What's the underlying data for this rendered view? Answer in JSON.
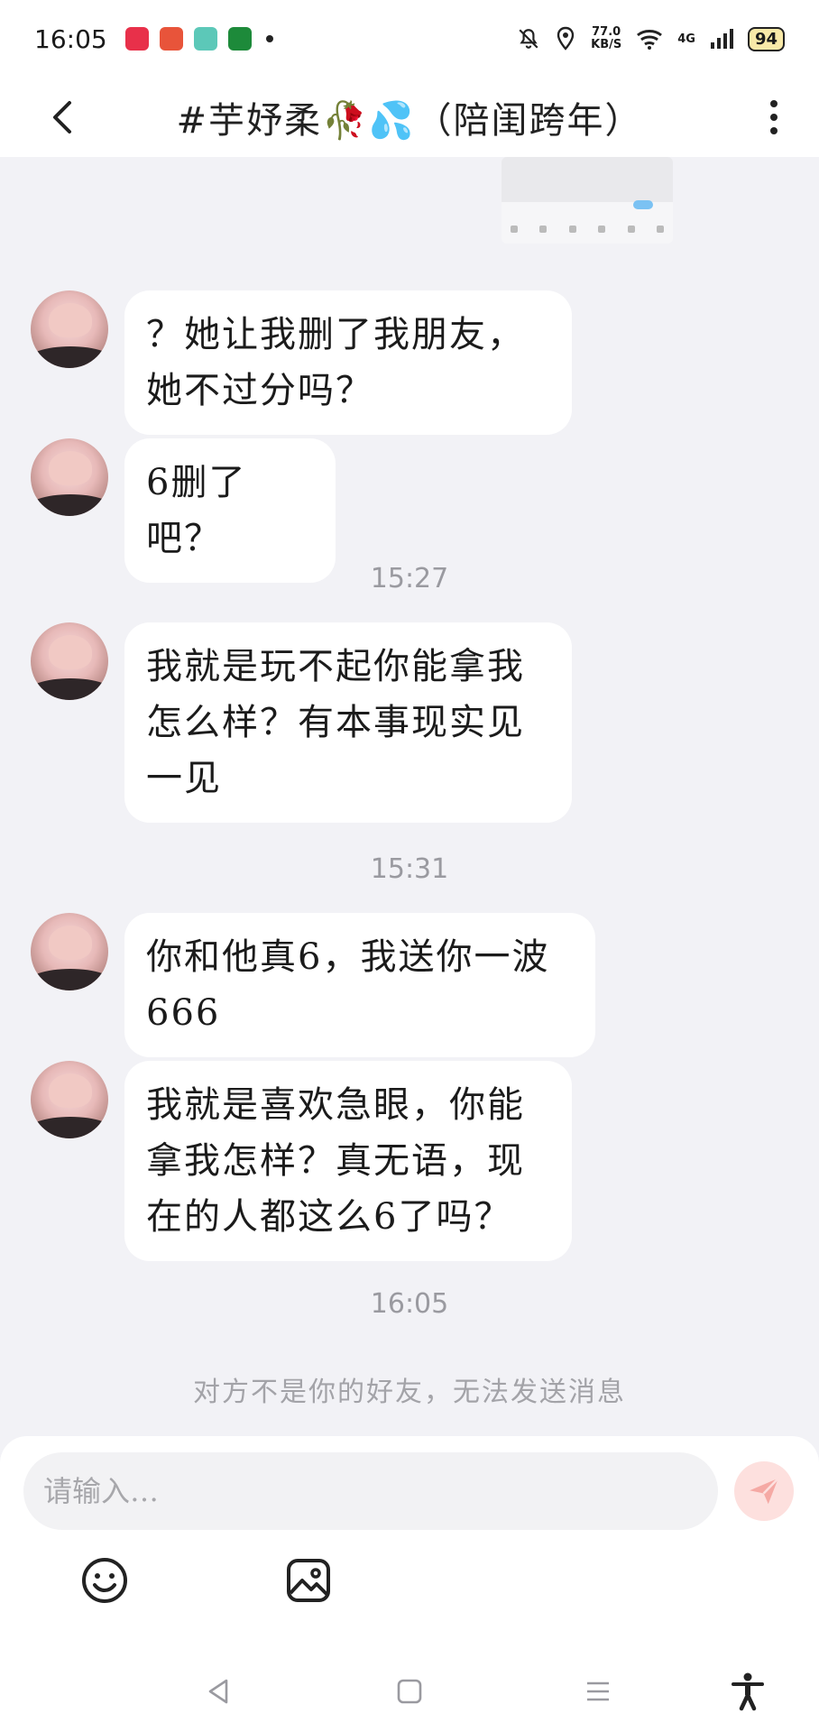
{
  "status_bar": {
    "time": "16:05",
    "speed_value": "77.0",
    "speed_unit": "KB/S",
    "network": "4G",
    "battery": "94",
    "app_icon_colors": [
      "#e8304a",
      "#e8543a",
      "#5cc8b8",
      "#1d8a3a"
    ]
  },
  "header": {
    "title": "#芋妤柔🥀💦（陪闺跨年）",
    "back_icon": "chevron-left-icon",
    "more_icon": "more-vertical-icon"
  },
  "messages": [
    {
      "text": "？她让我删了我朋友，她不过分吗？",
      "lines": [
        "？她让我删了我朋友，",
        "她不过分吗？"
      ]
    },
    {
      "text": "6删了吧？",
      "lines": [
        "6删了吧？"
      ]
    },
    {
      "text": "我就是玩不起你能拿我怎么样？有本事现实见一见",
      "lines": [
        "我就是玩不起你能拿我",
        "怎么样？有本事现实见",
        "一见"
      ]
    },
    {
      "text": "你和他真6，我送你一波666",
      "lines": [
        "你和他真6，我送你一波",
        "666"
      ]
    },
    {
      "text": "我就是喜欢急眼，你能拿我怎样？真无语，现在的人都这么6了吗？",
      "lines": [
        "我就是喜欢急眼，你能",
        "拿我怎样？真无语，现",
        "在的人都这么6了吗？"
      ]
    }
  ],
  "timestamps": [
    "15:27",
    "15:31",
    "16:05"
  ],
  "notice": "对方不是你的好友，无法发送消息",
  "input": {
    "placeholder": "请输入…",
    "send_icon": "send-icon",
    "emoji_icon": "emoji-icon",
    "image_icon": "image-icon"
  },
  "navbar": {
    "icons": [
      "back-triangle-icon",
      "home-square-icon",
      "menu-lines-icon",
      "accessibility-icon"
    ]
  },
  "colors": {
    "background": "#f2f2f6",
    "bubble": "#ffffff",
    "send_button": "#fde0de",
    "send_icon": "#f5a9a4"
  }
}
